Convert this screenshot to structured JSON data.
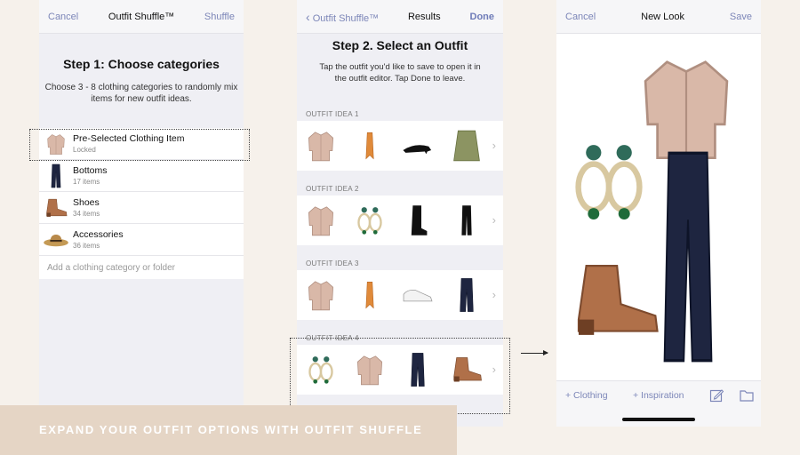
{
  "screen1": {
    "nav": {
      "left": "Cancel",
      "title": "Outfit Shuffle™",
      "right": "Shuffle"
    },
    "heading": "Step 1: Choose categories",
    "subtitle": "Choose 3 - 8 clothing categories to randomly mix items for new outfit ideas.",
    "categories": [
      {
        "name": "Pre-Selected Clothing Item",
        "meta": "Locked",
        "icon": "blouse-icon"
      },
      {
        "name": "Bottoms",
        "meta": "17 items",
        "icon": "jeans-icon"
      },
      {
        "name": "Shoes",
        "meta": "34 items",
        "icon": "boot-icon"
      },
      {
        "name": "Accessories",
        "meta": "36 items",
        "icon": "hat-icon"
      }
    ],
    "add_placeholder": "Add a clothing category or folder"
  },
  "screen2": {
    "nav": {
      "back": "Outfit Shuffle™",
      "title": "Results",
      "right": "Done"
    },
    "heading": "Step 2. Select an Outfit",
    "subtitle": "Tap the outfit you'd like to save to open it in the outfit editor. Tap Done to leave.",
    "ideas": [
      {
        "label": "OUTFIT IDEA 1",
        "items": [
          "blouse-icon",
          "scarf-icon",
          "heel-icon",
          "skirt-icon"
        ]
      },
      {
        "label": "OUTFIT IDEA 2",
        "items": [
          "blouse-icon",
          "earrings-icon",
          "tall-boot-icon",
          "pants-icon"
        ]
      },
      {
        "label": "OUTFIT IDEA 3",
        "items": [
          "blouse-icon",
          "scarf-icon",
          "sneaker-icon",
          "jeans-icon"
        ]
      },
      {
        "label": "OUTFIT IDEA 4",
        "items": [
          "earrings-icon",
          "blouse-icon",
          "jeans-icon",
          "boot-icon"
        ]
      }
    ]
  },
  "screen3": {
    "nav": {
      "left": "Cancel",
      "title": "New Look",
      "right": "Save"
    },
    "toolbar": {
      "clothing": "+ Clothing",
      "inspiration": "+ Inspiration"
    }
  },
  "banner": "EXPAND YOUR OUTFIT OPTIONS WITH OUTFIT SHUFFLE",
  "colors": {
    "accent": "#7c86b8",
    "banner": "#e5d5c5",
    "background": "#f6f1eb"
  }
}
